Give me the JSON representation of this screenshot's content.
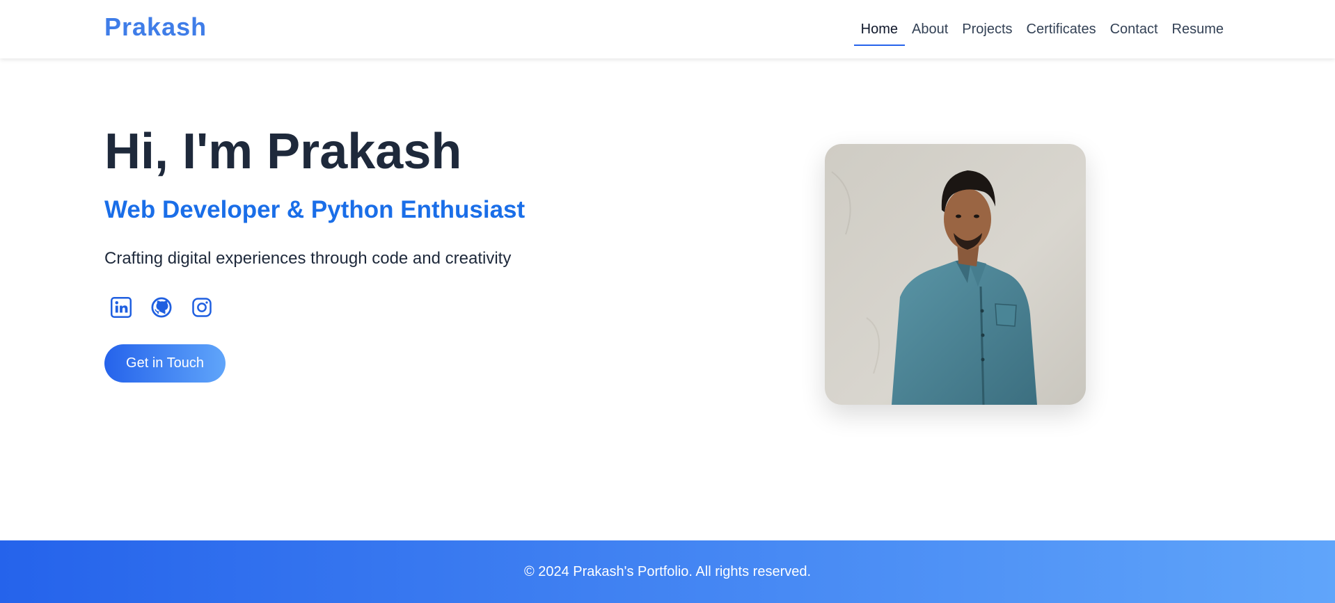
{
  "brand": {
    "name": "Prakash"
  },
  "nav": {
    "items": [
      {
        "label": "Home",
        "active": true
      },
      {
        "label": "About",
        "active": false
      },
      {
        "label": "Projects",
        "active": false
      },
      {
        "label": "Certificates",
        "active": false
      },
      {
        "label": "Contact",
        "active": false
      },
      {
        "label": "Resume",
        "active": false
      }
    ]
  },
  "hero": {
    "title": "Hi, I'm Prakash",
    "subtitle": "Web Developer & Python Enthusiast",
    "tagline": "Crafting digital experiences through code and creativity",
    "social_icons": [
      "linkedin-icon",
      "github-icon",
      "instagram-icon"
    ],
    "cta_label": "Get in Touch"
  },
  "footer": {
    "text": "© 2024 Prakash's Portfolio. All rights reserved."
  },
  "colors": {
    "brand": "#3f7de8",
    "accent": "#2563eb",
    "subtitle": "#1a6ee8",
    "heading": "#1e293b",
    "gradient_start": "#2563eb",
    "gradient_end": "#60a5fa"
  }
}
